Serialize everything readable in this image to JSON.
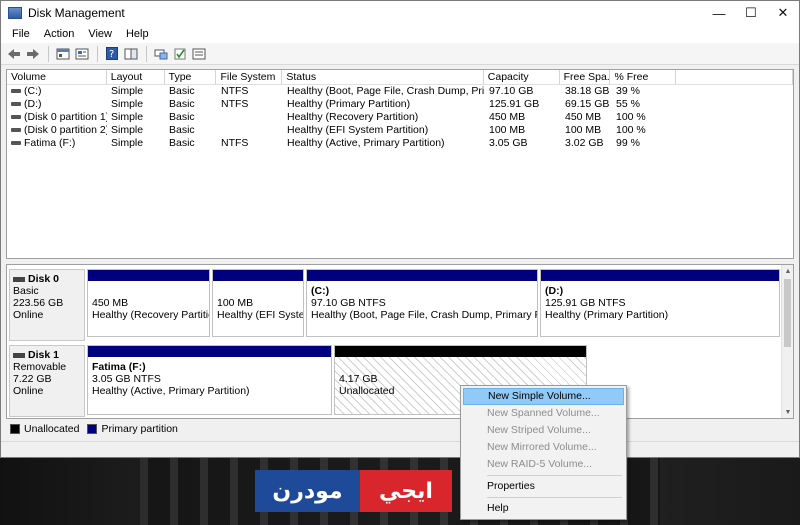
{
  "window": {
    "title": "Disk Management"
  },
  "menu": [
    "File",
    "Action",
    "View",
    "Help"
  ],
  "toolbar_icons": [
    "back-arrow-icon",
    "forward-arrow-icon",
    "console-tree-icon",
    "properties-icon",
    "help-icon",
    "details-pane-icon",
    "connect-icon",
    "checkmark-icon",
    "settings-icon"
  ],
  "volumes": {
    "columns": [
      "Volume",
      "Layout",
      "Type",
      "File System",
      "Status",
      "Capacity",
      "Free Spa...",
      "% Free"
    ],
    "rows": [
      [
        "(C:)",
        "Simple",
        "Basic",
        "NTFS",
        "Healthy (Boot, Page File, Crash Dump, Primar...",
        "97.10 GB",
        "38.18 GB",
        "39 %"
      ],
      [
        "(D:)",
        "Simple",
        "Basic",
        "NTFS",
        "Healthy (Primary Partition)",
        "125.91 GB",
        "69.15 GB",
        "55 %"
      ],
      [
        "(Disk 0 partition 1)",
        "Simple",
        "Basic",
        "",
        "Healthy (Recovery Partition)",
        "450 MB",
        "450 MB",
        "100 %"
      ],
      [
        "(Disk 0 partition 2)",
        "Simple",
        "Basic",
        "",
        "Healthy (EFI System Partition)",
        "100 MB",
        "100 MB",
        "100 %"
      ],
      [
        "Fatima (F:)",
        "Simple",
        "Basic",
        "NTFS",
        "Healthy (Active, Primary Partition)",
        "3.05 GB",
        "3.02 GB",
        "99 %"
      ]
    ]
  },
  "disk0": {
    "name": "Disk 0",
    "type": "Basic",
    "size": "223.56 GB",
    "state": "Online",
    "partitions": [
      {
        "title": "",
        "size": "450 MB",
        "status": "Healthy (Recovery Partition)"
      },
      {
        "title": "",
        "size": "100 MB",
        "status": "Healthy (EFI System"
      },
      {
        "title": "(C:)",
        "size": "97.10 GB NTFS",
        "status": "Healthy (Boot, Page File, Crash Dump, Primary Partition"
      },
      {
        "title": "(D:)",
        "size": "125.91 GB NTFS",
        "status": "Healthy (Primary Partition)"
      }
    ]
  },
  "disk1": {
    "name": "Disk 1",
    "type": "Removable",
    "size": "7.22 GB",
    "state": "Online",
    "partitions": [
      {
        "title": "Fatima  (F:)",
        "size": "3.05 GB NTFS",
        "status": "Healthy (Active, Primary Partition)"
      },
      {
        "title": "",
        "size": "4.17 GB",
        "status": "Unallocated"
      }
    ]
  },
  "legend": {
    "unallocated": "Unallocated",
    "primary": "Primary partition"
  },
  "colors": {
    "primary": "#00007f",
    "unallocated": "#000000",
    "menu_highlight": "#91c9f7"
  },
  "context_menu": {
    "items": [
      {
        "label": "New Simple Volume...",
        "enabled": true
      },
      {
        "label": "New Spanned Volume...",
        "enabled": false
      },
      {
        "label": "New Striped Volume...",
        "enabled": false
      },
      {
        "label": "New Mirrored Volume...",
        "enabled": false
      },
      {
        "label": "New RAID-5 Volume...",
        "enabled": false
      },
      {
        "label": "Properties",
        "enabled": true
      },
      {
        "label": "Help",
        "enabled": true
      }
    ]
  },
  "watermark": {
    "blue": "مودرن",
    "red": "ايجي"
  }
}
